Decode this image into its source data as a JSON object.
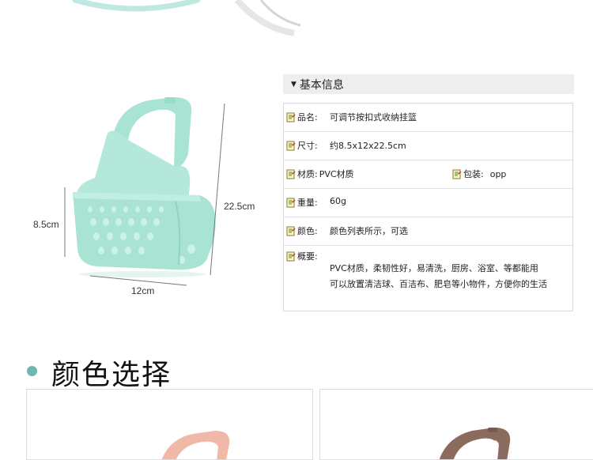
{
  "dimensions": {
    "height_label": "8.5cm",
    "length_label": "22.5cm",
    "width_label": "12cm"
  },
  "info": {
    "heading": "基本信息",
    "rows": {
      "name": {
        "label": "品名:",
        "value": "可调节按扣式收纳挂篮"
      },
      "size": {
        "label": "尺寸:",
        "value": "约8.5x12x22.5cm"
      },
      "material": {
        "label": "材质:",
        "value": "PVC材质"
      },
      "package": {
        "label": "包装:",
        "value": "opp"
      },
      "weight": {
        "label": "重量:",
        "value": "60g"
      },
      "color": {
        "label": "颜色:",
        "value": "颜色列表所示，可选"
      },
      "overview": {
        "label": "概要:",
        "lines": [
          "PVC材质，柔韧性好，易清洗，厨房、浴室、等都能用",
          "可以放置清洁球、百洁布、肥皂等小物件，方便你的生活"
        ]
      }
    }
  },
  "color_section": {
    "title": "颜色选择"
  },
  "colors": {
    "mint": "#a8e3d4",
    "pink": "#f0b8a6",
    "brown": "#8b6b5e",
    "accent": "#6fb8ae"
  }
}
